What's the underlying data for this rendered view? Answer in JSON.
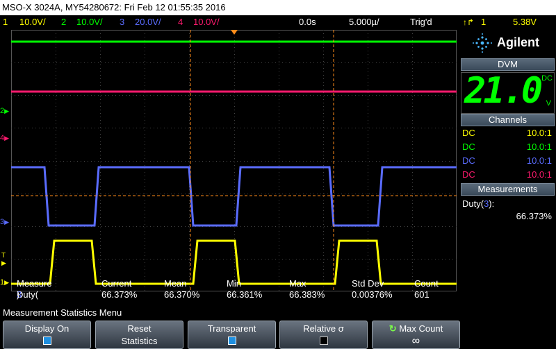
{
  "title": "MSO-X 3024A, MY54280672: Fri Feb 12 01:55:35 2016",
  "status": {
    "ch1_num": "1",
    "ch1_scale": "10.0V/",
    "ch2_num": "2",
    "ch2_scale": "10.0V/",
    "ch3_num": "3",
    "ch3_scale": "20.0V/",
    "ch4_num": "4",
    "ch4_scale": "10.0V/",
    "delay": "0.0s",
    "timebase": "5.000µ/",
    "trigger_state": "Trig'd",
    "trig_source": "1",
    "trig_level": "5.38V"
  },
  "markers": {
    "ch2": "2",
    "ch4": "4",
    "ch3": "3",
    "ch1": "1",
    "trig": "T"
  },
  "stats": {
    "headers": [
      "Measure",
      "Current",
      "Mean",
      "Min",
      "Max",
      "Std Dev",
      "Count"
    ],
    "row_label": "Duty(",
    "row_channel": "3",
    "row_label_end": "):",
    "values": [
      "66.373%",
      "66.370%",
      "66.361%",
      "66.383%",
      "0.00376%",
      "601"
    ]
  },
  "panel": {
    "brand": "Agilent",
    "dvm_header": "DVM",
    "dvm_value": "21.0",
    "dvm_mode": "DC",
    "dvm_unit": "V",
    "channels_header": "Channels",
    "channels": [
      {
        "coupling": "DC",
        "probe": "10.0:1",
        "color": "#ffff00"
      },
      {
        "coupling": "DC",
        "probe": "10.0:1",
        "color": "#00ff00"
      },
      {
        "coupling": "DC",
        "probe": "10.0:1",
        "color": "#5a6cff"
      },
      {
        "coupling": "DC",
        "probe": "10.0:1",
        "color": "#ff1a6e"
      }
    ],
    "measurements_header": "Measurements",
    "meas_label": "Duty(3):",
    "meas_value": "66.373%"
  },
  "menu": {
    "title": "Measurement Statistics Menu",
    "display_on": "Display On",
    "reset_1": "Reset",
    "reset_2": "Statistics",
    "transparent": "Transparent",
    "relative": "Relative σ",
    "max_count": "Max Count",
    "max_count_value": "∞"
  },
  "colors": {
    "ch1": "#ffff00",
    "ch2": "#00ff00",
    "ch3": "#5a6cff",
    "ch4": "#ff1a6e",
    "trigger": "#ff8c1a"
  }
}
